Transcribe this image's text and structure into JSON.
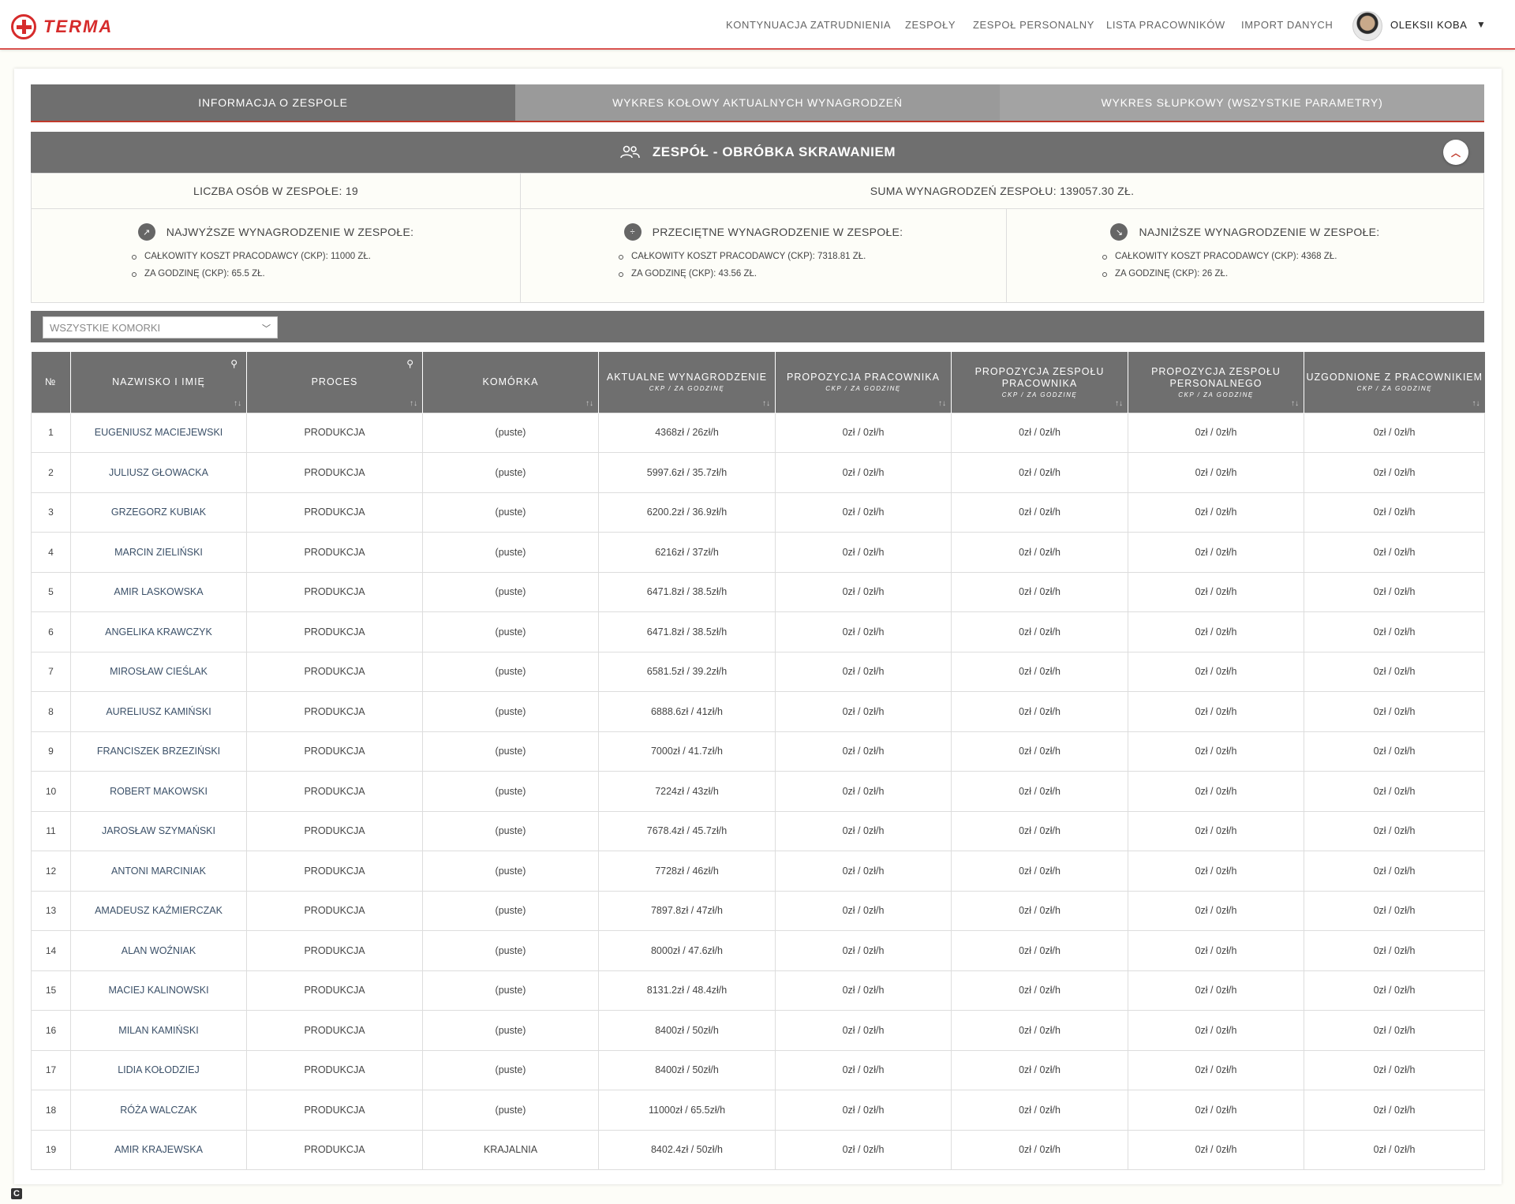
{
  "brand": {
    "name": "TERMA",
    "color": "#d62b2b"
  },
  "nav": {
    "items": [
      "KONTYNUACJA ZATRUDNIENIA",
      "ZESPOŁY",
      "ZESPOŁ PERSONALNY",
      "LISTA PRACOWNIKÓW",
      "IMPORT DANYCH"
    ],
    "user": "OLEKSII KOBA"
  },
  "tabs": [
    "INFORMACJA O ZESPOLE",
    "WYKRES KOŁOWY AKTUALNYCH WYNAGRODZEŃ",
    "WYKRES SŁUPKOWY (WSZYSTKIE PARAMETRY)"
  ],
  "team": {
    "title": "ZESPÓŁ - OBRÓBKA SKRAWANIEM",
    "count": "LICZBA OSÓB W ZESPOŁE: 19",
    "sum": "SUMA WYNAGRODZEŃ ZESPOŁU: 139057.30 ZŁ."
  },
  "stats": [
    {
      "icon": "trending-up-icon",
      "title": "NAJWYŻSZE WYNAGRODZENIE W ZESPOŁE:",
      "ckp": "CAŁKOWITY KOSZT PRACODAWCY (CKP): 11000 ZŁ.",
      "hour": "ZA GODZINĘ (CKP): 65.5 ZŁ."
    },
    {
      "icon": "divide-icon",
      "title": "PRZECIĘTNE WYNAGRODZENIE W ZESPOŁE:",
      "ckp": "CAŁKOWITY KOSZT PRACODAWCY (CKP): 7318.81 ZŁ.",
      "hour": "ZA GODZINĘ (CKP): 43.56 ZŁ."
    },
    {
      "icon": "trending-down-icon",
      "title": "NAJNIŻSZE WYNAGRODZENIE W ZESPOŁE:",
      "ckp": "CAŁKOWITY KOSZT PRACODAWCY (CKP): 4368 ZŁ.",
      "hour": "ZA GODZINĘ (CKP): 26 ZŁ."
    }
  ],
  "filter": {
    "selected": "WSZYSTKIE KOMORKI"
  },
  "table": {
    "headers": [
      {
        "title": "№",
        "sub": ""
      },
      {
        "title": "NAZWISKO I IMIĘ",
        "sub": ""
      },
      {
        "title": "PROCES",
        "sub": ""
      },
      {
        "title": "KOMÓRKA",
        "sub": ""
      },
      {
        "title": "AKTUALNE WYNAGRODZENIE",
        "sub": "CKP / ZA GODZINĘ"
      },
      {
        "title": "PROPOZYCJA PRACOWNIKA",
        "sub": "CKP / ZA GODZINĘ"
      },
      {
        "title": "PROPOZYCJA ZESPOŁU PRACOWNIKA",
        "sub": "CKP / ZA GODZINĘ"
      },
      {
        "title": "PROPOZYCJA ZESPOŁU PERSONALNEGO",
        "sub": "CKP / ZA GODZINĘ"
      },
      {
        "title": "UZGODNIONE Z PRACOWNIKIEM",
        "sub": "CKP / ZA GODZINĘ"
      }
    ],
    "rows": [
      [
        "1",
        "EUGENIUSZ MACIEJEWSKI",
        "PRODUKCJA",
        "(puste)",
        "4368zł / 26zł/h",
        "0zł / 0zł/h",
        "0zł / 0zł/h",
        "0zł / 0zł/h",
        "0zł / 0zł/h"
      ],
      [
        "2",
        "JULIUSZ GŁOWACKA",
        "PRODUKCJA",
        "(puste)",
        "5997.6zł / 35.7zł/h",
        "0zł / 0zł/h",
        "0zł / 0zł/h",
        "0zł / 0zł/h",
        "0zł / 0zł/h"
      ],
      [
        "3",
        "GRZEGORZ KUBIAK",
        "PRODUKCJA",
        "(puste)",
        "6200.2zł / 36.9zł/h",
        "0zł / 0zł/h",
        "0zł / 0zł/h",
        "0zł / 0zł/h",
        "0zł / 0zł/h"
      ],
      [
        "4",
        "MARCIN ZIELIŃSKI",
        "PRODUKCJA",
        "(puste)",
        "6216zł / 37zł/h",
        "0zł / 0zł/h",
        "0zł / 0zł/h",
        "0zł / 0zł/h",
        "0zł / 0zł/h"
      ],
      [
        "5",
        "AMIR LASKOWSKA",
        "PRODUKCJA",
        "(puste)",
        "6471.8zł / 38.5zł/h",
        "0zł / 0zł/h",
        "0zł / 0zł/h",
        "0zł / 0zł/h",
        "0zł / 0zł/h"
      ],
      [
        "6",
        "ANGELIKA KRAWCZYK",
        "PRODUKCJA",
        "(puste)",
        "6471.8zł / 38.5zł/h",
        "0zł / 0zł/h",
        "0zł / 0zł/h",
        "0zł / 0zł/h",
        "0zł / 0zł/h"
      ],
      [
        "7",
        "MIROSŁAW CIEŚLAK",
        "PRODUKCJA",
        "(puste)",
        "6581.5zł / 39.2zł/h",
        "0zł / 0zł/h",
        "0zł / 0zł/h",
        "0zł / 0zł/h",
        "0zł / 0zł/h"
      ],
      [
        "8",
        "AURELIUSZ KAMIŃSKI",
        "PRODUKCJA",
        "(puste)",
        "6888.6zł / 41zł/h",
        "0zł / 0zł/h",
        "0zł / 0zł/h",
        "0zł / 0zł/h",
        "0zł / 0zł/h"
      ],
      [
        "9",
        "FRANCISZEK BRZEZIŃSKI",
        "PRODUKCJA",
        "(puste)",
        "7000zł / 41.7zł/h",
        "0zł / 0zł/h",
        "0zł / 0zł/h",
        "0zł / 0zł/h",
        "0zł / 0zł/h"
      ],
      [
        "10",
        "ROBERT MAKOWSKI",
        "PRODUKCJA",
        "(puste)",
        "7224zł / 43zł/h",
        "0zł / 0zł/h",
        "0zł / 0zł/h",
        "0zł / 0zł/h",
        "0zł / 0zł/h"
      ],
      [
        "11",
        "JAROSŁAW SZYMAŃSKI",
        "PRODUKCJA",
        "(puste)",
        "7678.4zł / 45.7zł/h",
        "0zł / 0zł/h",
        "0zł / 0zł/h",
        "0zł / 0zł/h",
        "0zł / 0zł/h"
      ],
      [
        "12",
        "ANTONI MARCINIAK",
        "PRODUKCJA",
        "(puste)",
        "7728zł / 46zł/h",
        "0zł / 0zł/h",
        "0zł / 0zł/h",
        "0zł / 0zł/h",
        "0zł / 0zł/h"
      ],
      [
        "13",
        "AMADEUSZ KAŹMIERCZAK",
        "PRODUKCJA",
        "(puste)",
        "7897.8zł / 47zł/h",
        "0zł / 0zł/h",
        "0zł / 0zł/h",
        "0zł / 0zł/h",
        "0zł / 0zł/h"
      ],
      [
        "14",
        "ALAN WOŹNIAK",
        "PRODUKCJA",
        "(puste)",
        "8000zł / 47.6zł/h",
        "0zł / 0zł/h",
        "0zł / 0zł/h",
        "0zł / 0zł/h",
        "0zł / 0zł/h"
      ],
      [
        "15",
        "MACIEJ KALINOWSKI",
        "PRODUKCJA",
        "(puste)",
        "8131.2zł / 48.4zł/h",
        "0zł / 0zł/h",
        "0zł / 0zł/h",
        "0zł / 0zł/h",
        "0zł / 0zł/h"
      ],
      [
        "16",
        "MILAN KAMIŃSKI",
        "PRODUKCJA",
        "(puste)",
        "8400zł / 50zł/h",
        "0zł / 0zł/h",
        "0zł / 0zł/h",
        "0zł / 0zł/h",
        "0zł / 0zł/h"
      ],
      [
        "17",
        "LIDIA KOŁODZIEJ",
        "PRODUKCJA",
        "(puste)",
        "8400zł / 50zł/h",
        "0zł / 0zł/h",
        "0zł / 0zł/h",
        "0zł / 0zł/h",
        "0zł / 0zł/h"
      ],
      [
        "18",
        "RÓŻA WALCZAK",
        "PRODUKCJA",
        "(puste)",
        "11000zł / 65.5zł/h",
        "0zł / 0zł/h",
        "0zł / 0zł/h",
        "0zł / 0zł/h",
        "0zł / 0zł/h"
      ],
      [
        "19",
        "AMIR KRAJEWSKA",
        "PRODUKCJA",
        "KRAJALNIA",
        "8402.4zł / 50zł/h",
        "0zł / 0zł/h",
        "0zł / 0zł/h",
        "0zł / 0zł/h",
        "0zł / 0zł/h"
      ]
    ]
  }
}
